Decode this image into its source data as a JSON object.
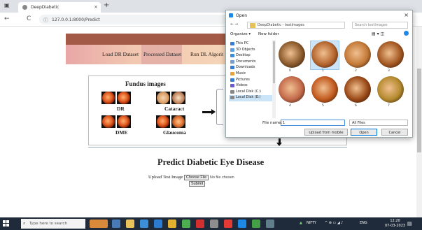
{
  "browser": {
    "tab_title": "DeepDiabetic",
    "tab_close": "×",
    "new_tab": "+",
    "url": "127.0.0.1:8000/Predict",
    "back": "←",
    "reload": "C",
    "win_min": "—",
    "win_max": "☐",
    "win_close": "×"
  },
  "navbar": {
    "items": [
      "Load DR Dataset",
      "Processed Dataset",
      "Run DL Algorit"
    ]
  },
  "flow": {
    "fundus_title": "Fundus images",
    "labels": [
      "DR",
      "Cataract",
      "DME",
      "Glaucoma"
    ]
  },
  "main": {
    "title": "Predict Diabetic Eye Disease",
    "upload_label": "Upload Test Image",
    "choose_button": "Choose File",
    "no_file": "No file chosen",
    "submit": "Submit"
  },
  "dialog": {
    "title": "Open",
    "close": "×",
    "path": "DeepDiabetic › testImages",
    "search_placeholder": "Search testImages",
    "organize": "Organize ▾",
    "new_folder": "New folder",
    "tree": [
      "This PC",
      "3D Objects",
      "Desktop",
      "Documents",
      "Downloads",
      "Music",
      "Pictures",
      "Videos",
      "Local Disk (C:)",
      "Local Disk (E:)"
    ],
    "tree_selected": 9,
    "thumbnails": [
      {
        "num": "0",
        "color": "#8a5a2c"
      },
      {
        "num": "1",
        "color": "#b5652e"
      },
      {
        "num": "2",
        "color": "#c47a38"
      },
      {
        "num": "3",
        "color": "#a45822"
      },
      {
        "num": "4",
        "color": "#c46a4a"
      },
      {
        "num": "5",
        "color": "#c25a1e"
      },
      {
        "num": "6",
        "color": "#9b4a18"
      },
      {
        "num": "7",
        "color": "#b58a2e"
      }
    ],
    "selected_thumb": 1,
    "filename_label": "File name:",
    "filename_value": "1",
    "filetype": "All Files",
    "upload_mobile": "Upload from mobile",
    "open": "Open",
    "cancel": "Cancel"
  },
  "taskbar": {
    "search": "Type here to search",
    "nifty": "NIFTY",
    "lang": "ENG",
    "time": "12:20",
    "date": "07-03-2023"
  }
}
